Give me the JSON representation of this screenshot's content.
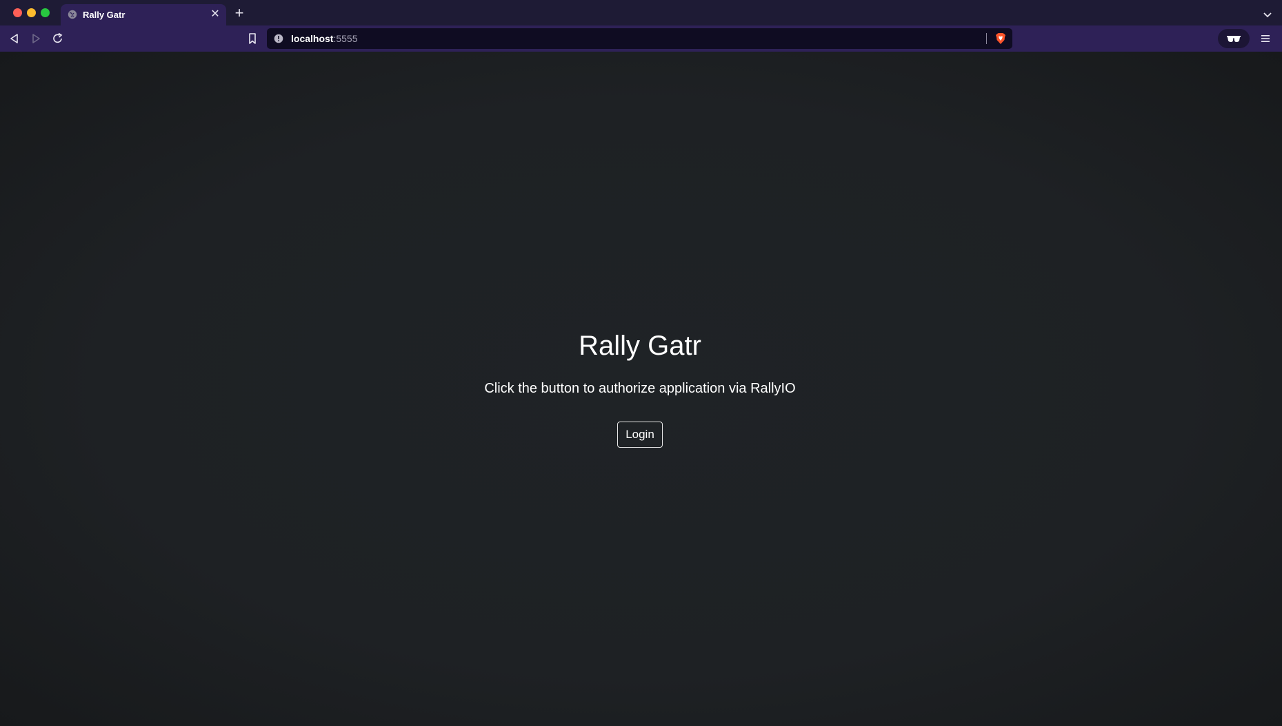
{
  "browser": {
    "tab": {
      "title": "Rally Gatr"
    },
    "address": {
      "host": "localhost",
      "port": ":5555"
    },
    "icons": {
      "back": "back-arrow-icon",
      "forward": "forward-arrow-icon",
      "reload": "reload-icon",
      "bookmark": "bookmark-icon",
      "info": "site-info-icon",
      "shield": "brave-shield-icon",
      "reader": "reader-mode-icon",
      "menu": "hamburger-menu-icon"
    },
    "colors": {
      "tabstrip": "#1e1b35",
      "toolbar": "#2e2157",
      "urlbar": "#0f0c22",
      "content": "#1e2124"
    }
  },
  "page": {
    "title": "Rally Gatr",
    "subtitle": "Click the button to authorize application via RallyIO",
    "login_label": "Login"
  }
}
